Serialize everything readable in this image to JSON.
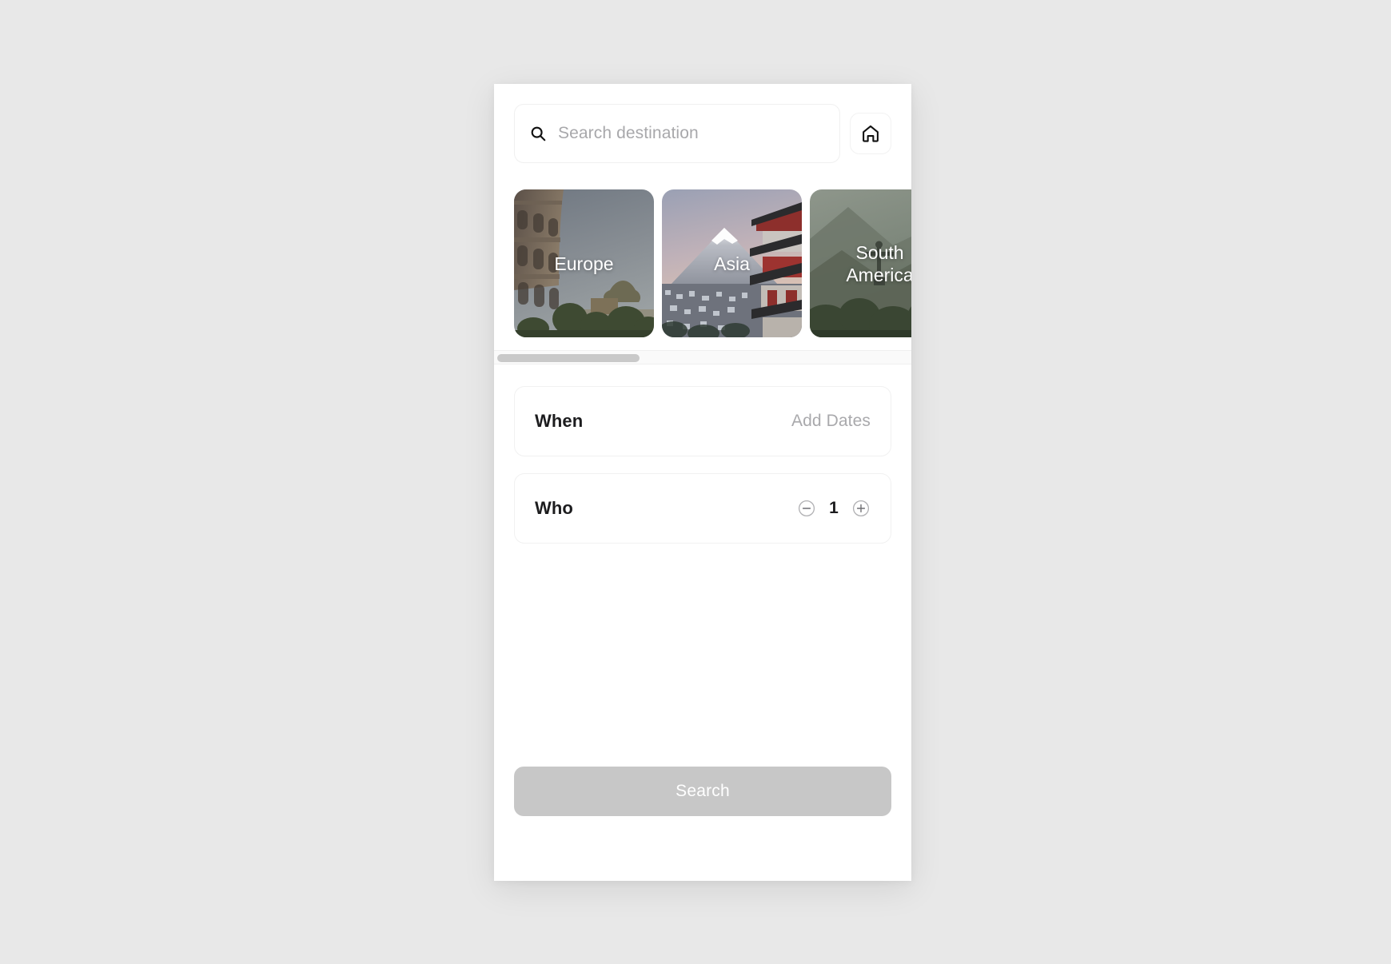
{
  "background_color": "#e8e8e8",
  "panel_background": "#ffffff",
  "search": {
    "icon": "search-icon",
    "placeholder": "Search destination",
    "value": ""
  },
  "home_button": {
    "icon": "home-icon",
    "label": "Home"
  },
  "destinations": {
    "scroll_position": "start",
    "items": [
      {
        "label": "Europe",
        "scene": "colosseum"
      },
      {
        "label": "Asia",
        "scene": "mount-fuji-pagoda"
      },
      {
        "label": "South\nAmerica",
        "scene": "christ-the-redeemer"
      }
    ]
  },
  "options": [
    {
      "title": "When",
      "value": "Add Dates"
    }
  ],
  "who": {
    "title": "Who",
    "count": "1",
    "decrement_icon": "minus-circle-icon",
    "increment_icon": "plus-circle-icon"
  },
  "search_button": {
    "label": "Search",
    "enabled": false,
    "color": "#c7c7c7",
    "text_color": "#ffffff"
  }
}
